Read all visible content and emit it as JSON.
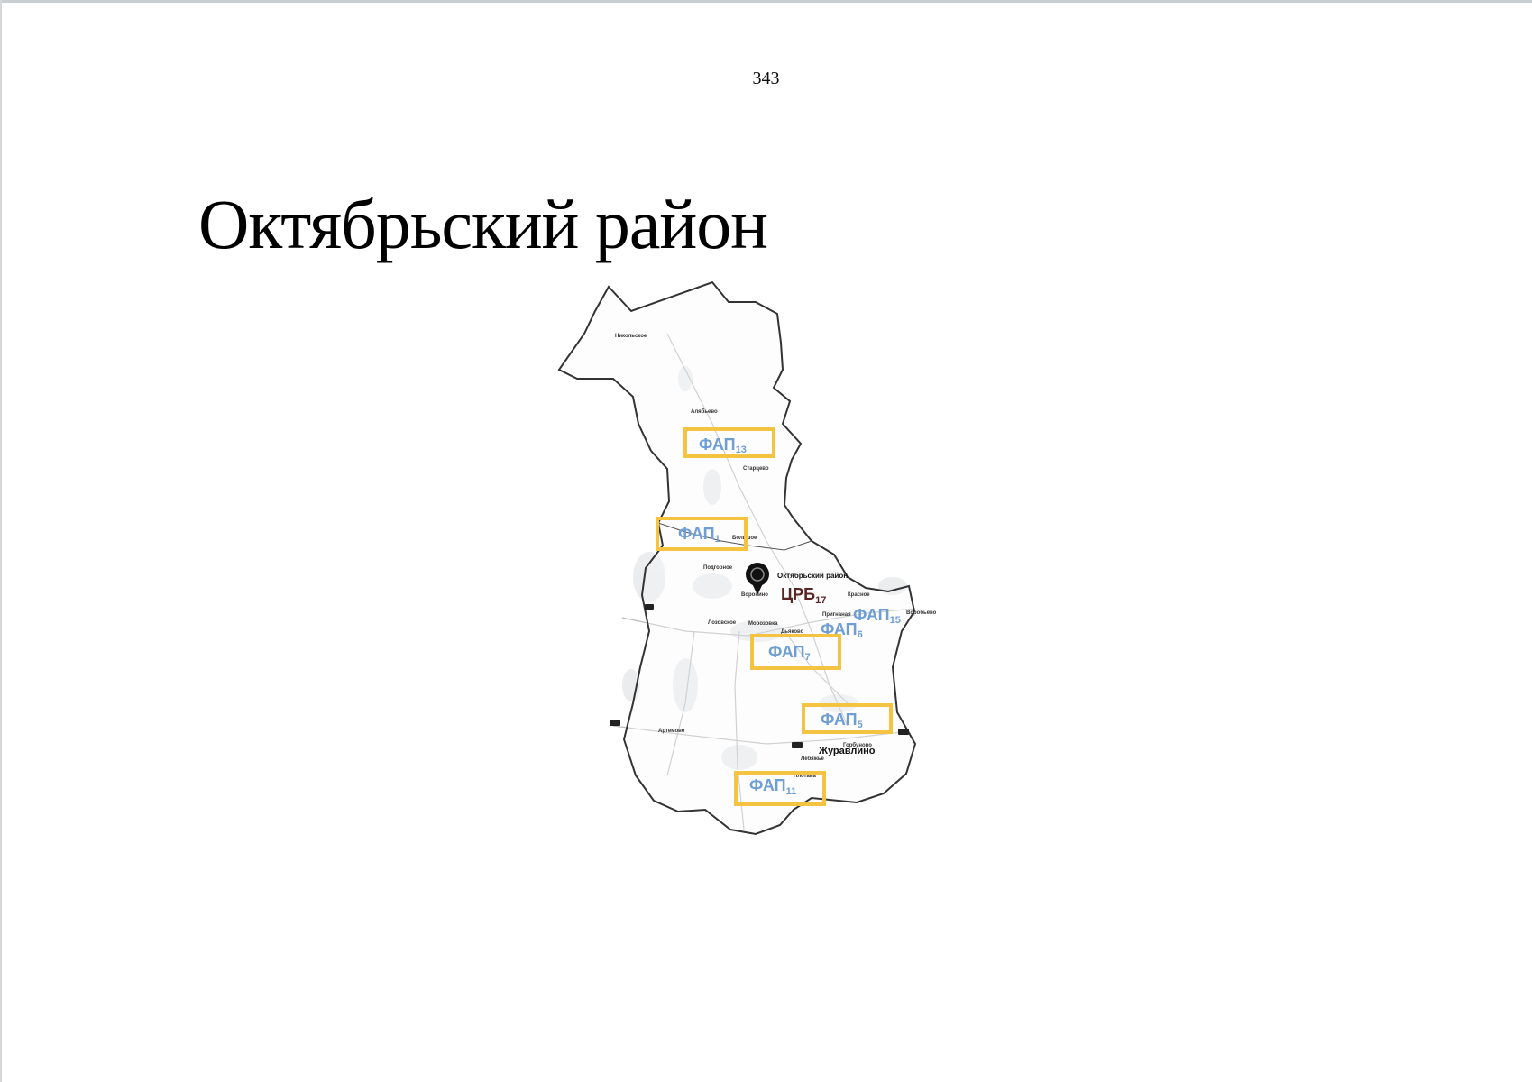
{
  "page": {
    "number": "343",
    "title": "Октябрьский район"
  },
  "colors": {
    "fap_box_border": "#f5c342",
    "fap_text": "#6e9ed3",
    "crb_text": "#5b2424",
    "border_line": "#333333"
  },
  "map": {
    "place_labels": {
      "nikolskoe": "Никольское",
      "alabino": "Алябьево",
      "starovo": "Старцево",
      "bolshoe": "Большое",
      "podgornoe": "Подгорное",
      "voronino": "Воронино",
      "district": "Октябрьский район",
      "krasnoe": "Красное",
      "prignaya": "Пригнаная",
      "vorobievo": "Воробьёво",
      "lozovskoe": "Лозовское",
      "morozovka": "Морозовка",
      "dyakovo": "Дьяково",
      "artemovo": "Артемово",
      "zhuravlino": "Журавлино",
      "gorbuno": "Горбуново",
      "lebyazhye": "Лебяжье",
      "plotava": "Плотава"
    },
    "facilities": [
      {
        "id": "fap-13",
        "name": "ФАП",
        "sub": "13"
      },
      {
        "id": "fap-1",
        "name": "ФАП",
        "sub": "1"
      },
      {
        "id": "crb-17",
        "name": "ЦРБ",
        "sub": "17"
      },
      {
        "id": "fap-15",
        "name": "ФАП",
        "sub": "15"
      },
      {
        "id": "fap-6",
        "name": "ФАП",
        "sub": "6"
      },
      {
        "id": "fap-7",
        "name": "ФАП",
        "sub": "7"
      },
      {
        "id": "fap-5",
        "name": "ФАП",
        "sub": "5"
      },
      {
        "id": "fap-11",
        "name": "ФАП",
        "sub": "11"
      }
    ]
  }
}
